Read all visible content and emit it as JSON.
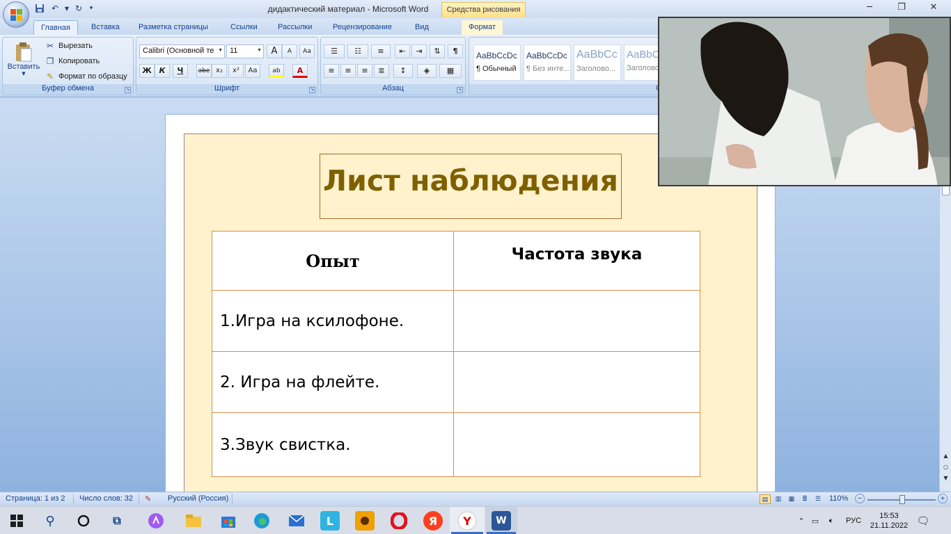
{
  "window": {
    "title": "дидактический материал - Microsoft Word",
    "context_tab_title": "Средства рисования",
    "minimize": "─",
    "maximize": "❐",
    "close": "✕"
  },
  "ribbon": {
    "tabs": [
      "Главная",
      "Вставка",
      "Разметка страницы",
      "Ссылки",
      "Рассылки",
      "Рецензирование",
      "Вид",
      "Формат"
    ],
    "active_tab": "Главная",
    "clipboard": {
      "paste": "Вставить",
      "cut": "Вырезать",
      "copy": "Копировать",
      "format_painter": "Формат по образцу",
      "label": "Буфер обмена"
    },
    "font": {
      "font_name": "Calibri (Основной те",
      "font_size": "11",
      "grow": "A",
      "shrink": "A",
      "clear": "Aa",
      "bold": "Ж",
      "italic": "К",
      "underline": "Ч",
      "strike": "abe",
      "subscript": "x₂",
      "superscript": "x²",
      "case": "Aa",
      "highlight": "ab",
      "font_color": "A",
      "label": "Шрифт"
    },
    "paragraph": {
      "label": "Абзац",
      "pilcrow": "¶"
    },
    "styles": {
      "items": [
        {
          "sample": "AaBbCcDc",
          "name": "¶ Обычный"
        },
        {
          "sample": "AaBbCcDc",
          "name": "¶ Без инте..."
        },
        {
          "sample": "AaBbCc",
          "name": "Заголово..."
        },
        {
          "sample": "AaBbC",
          "name": "Заголово"
        }
      ],
      "label": "С"
    }
  },
  "document": {
    "heading": "Лист наблюдения",
    "table": {
      "headers": [
        "Опыт",
        "Частота звука"
      ],
      "rows": [
        [
          "1.Игра на ксилофоне.",
          ""
        ],
        [
          "2. Игра на флейте.",
          ""
        ],
        [
          "3.Звук свистка.",
          ""
        ]
      ]
    }
  },
  "statusbar": {
    "page": "Страница: 1 из 2",
    "words": "Число слов: 32",
    "language": "Русский (Россия)",
    "zoom": "110%",
    "zoom_level_percent": 110
  },
  "taskbar": {
    "lang": "РУС",
    "time": "15:53",
    "date": "21.11.2022",
    "yandex_letter": "Я",
    "yandex_browser_letter": "Y",
    "lingualeo_letter": "L",
    "word_letter": "W"
  },
  "colors": {
    "heading": "#7f6000",
    "shape_fill": "#fff2cc",
    "table_border": "#d4924a",
    "ribbon_text": "#15428b"
  }
}
